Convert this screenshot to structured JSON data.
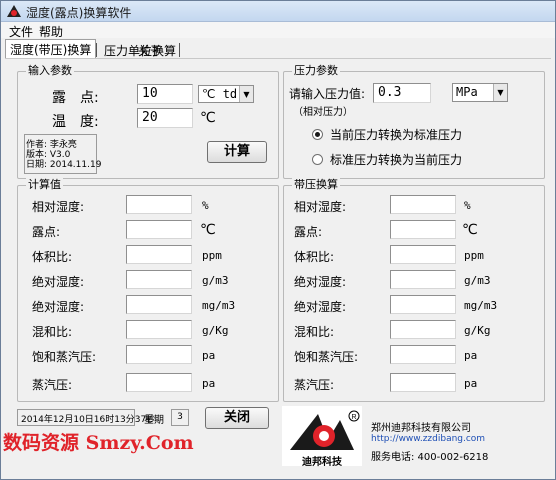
{
  "window": {
    "title": "湿度(露点)换算软件"
  },
  "menu": [
    "文件",
    "帮助"
  ],
  "tabs": [
    "湿度(带压)换算",
    "压力单位换算",
    "关于"
  ],
  "input_group": {
    "title": "输入参数",
    "dewpoint_label": "露　点:",
    "dewpoint_value": "10",
    "dewpoint_unit_select": "℃ td",
    "temperature_label": "温　度:",
    "temperature_value": "20",
    "temperature_unit": "℃"
  },
  "info": {
    "author": "作者: 李永亮",
    "version": "版本: V3.0",
    "date": "日期: 2014.11.19"
  },
  "calc_button": "计算",
  "pressure_group": {
    "title": "压力参数",
    "label": "请输入压力值:",
    "sub_label": "（相对压力）",
    "value": "0.3",
    "unit_select": "MPa",
    "radio_1": "当前压力转换为标准压力",
    "radio_2": "标准压力转换为当前压力",
    "radio_selected": 1
  },
  "calc_group": {
    "title": "计算值",
    "rows": [
      {
        "label": "相对湿度:",
        "unit": "%"
      },
      {
        "label": "露点:",
        "unit": "℃"
      },
      {
        "label": "体积比:",
        "unit": "ppm"
      },
      {
        "label": "绝对湿度:",
        "unit": "g/m3"
      },
      {
        "label": "绝对湿度:",
        "unit": "mg/m3"
      },
      {
        "label": "混和比:",
        "unit": "g/Kg"
      },
      {
        "label": "饱和蒸汽压:",
        "unit": "pa"
      },
      {
        "label": "蒸汽压:",
        "unit": "pa"
      }
    ]
  },
  "pressure_calc_group": {
    "title": "带压换算",
    "rows": [
      {
        "label": "相对湿度:",
        "unit": "%"
      },
      {
        "label": "露点:",
        "unit": "℃"
      },
      {
        "label": "体积比:",
        "unit": "ppm"
      },
      {
        "label": "绝对湿度:",
        "unit": "g/m3"
      },
      {
        "label": "绝对湿度:",
        "unit": "mg/m3"
      },
      {
        "label": "混和比:",
        "unit": "g/Kg"
      },
      {
        "label": "饱和蒸汽压:",
        "unit": "pa"
      },
      {
        "label": "蒸汽压:",
        "unit": "pa"
      }
    ]
  },
  "status": {
    "datetime": "2014年12月10日16时13分37秒",
    "weekday_label": "星期",
    "weekday_value": "3"
  },
  "close_button": "关闭",
  "company": {
    "logo_text": "迪邦科技",
    "name": "郑州迪邦科技有限公司",
    "url": "http://www.zzdibang.com",
    "phone": "服务电话: 400-002-6218"
  },
  "watermark": "数码资源 Smzy.Com",
  "colors": {
    "accent_red": "#e0232a",
    "title_bar": "#c3d7ef"
  }
}
